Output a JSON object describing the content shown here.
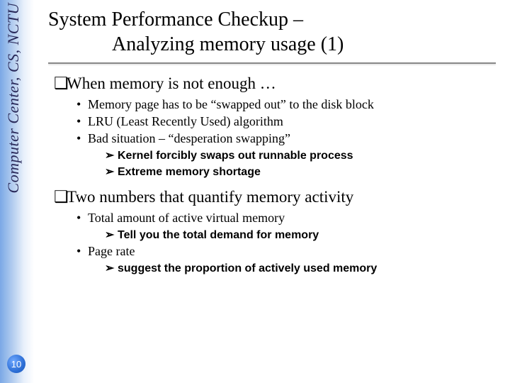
{
  "sidebar": {
    "label": "Computer Center, CS, NCTU",
    "page_number": "10"
  },
  "title": {
    "line1": "System Performance Checkup –",
    "line2": "Analyzing memory usage (1)"
  },
  "sections": [
    {
      "heading": "When memory is not enough …",
      "bullets": [
        {
          "text": "Memory page has to be “swapped out” to the disk block"
        },
        {
          "text": "LRU (Least Recently Used) algorithm"
        },
        {
          "text": "Bad situation – “desperation swapping”",
          "sub": [
            "Kernel forcibly swaps out runnable process",
            "Extreme memory shortage"
          ]
        }
      ]
    },
    {
      "heading": "Two numbers that quantify memory activity",
      "bullets": [
        {
          "text": "Total amount of active virtual memory",
          "sub": [
            "Tell you the total demand for memory"
          ]
        },
        {
          "text": "Page rate",
          "sub": [
            "suggest the proportion of actively used memory"
          ]
        }
      ]
    }
  ],
  "markers": {
    "square": "❑",
    "dot": "•",
    "arrow": "➢"
  }
}
